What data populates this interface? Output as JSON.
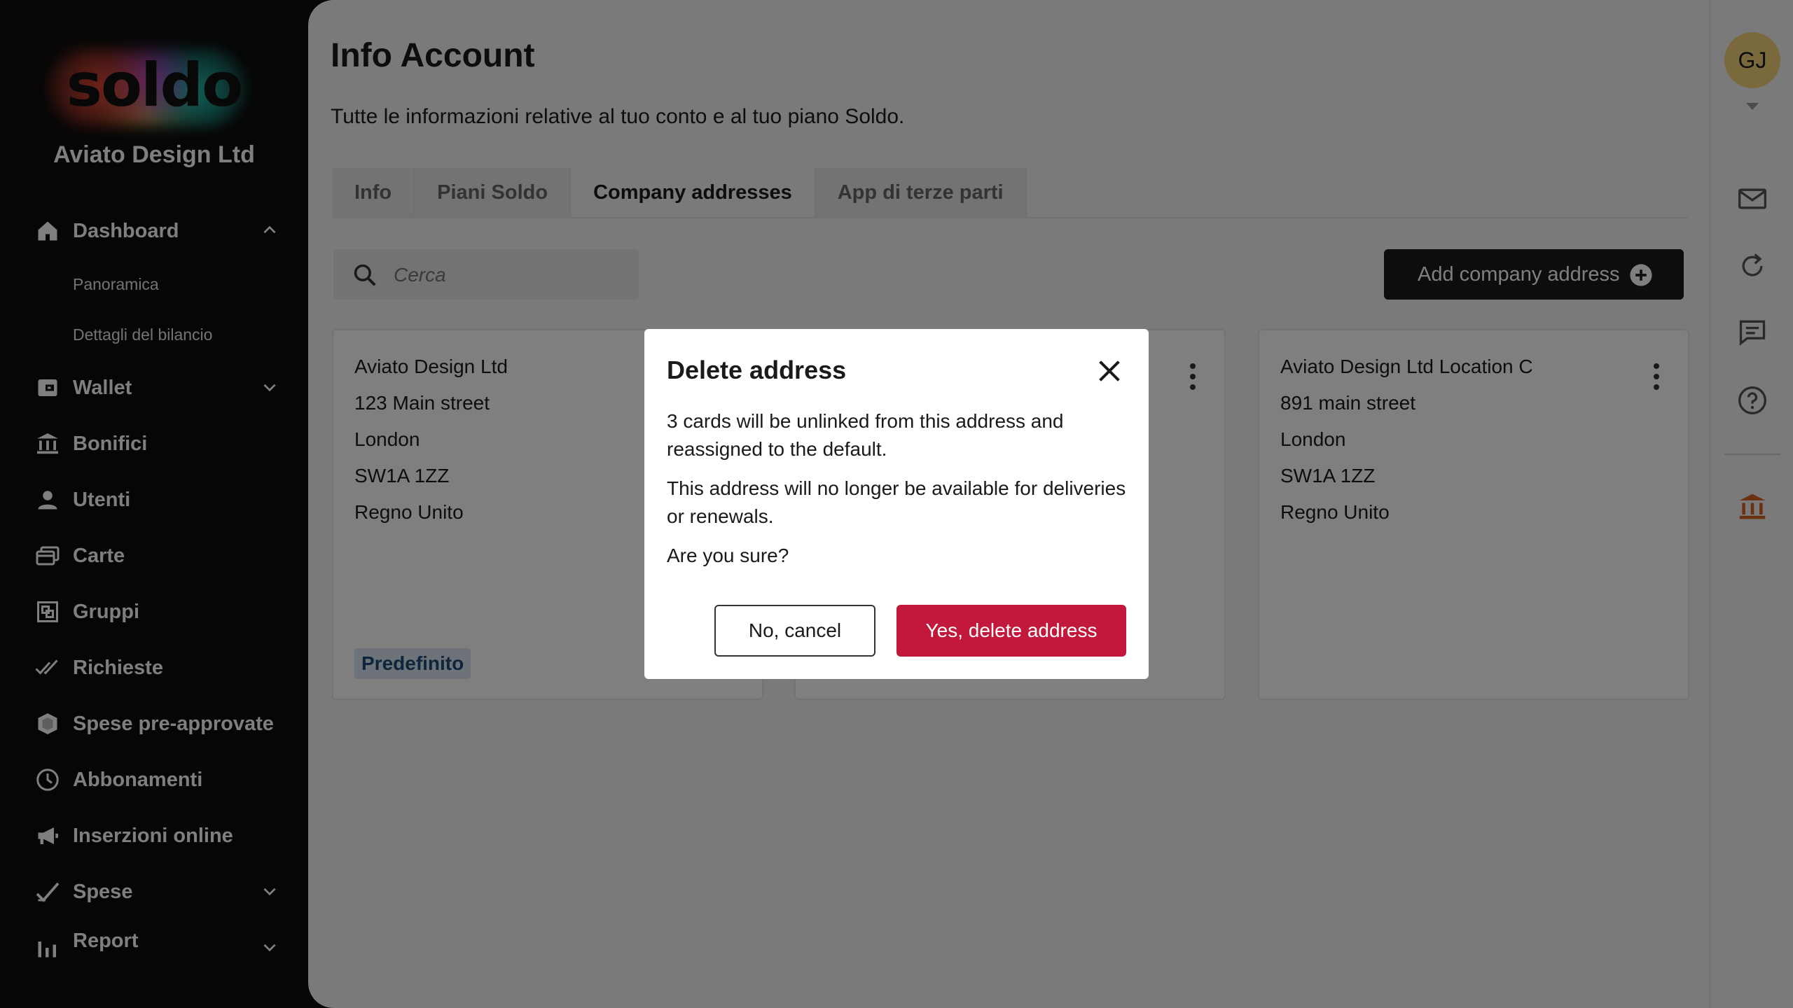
{
  "brand": {
    "logo_text": "soldo",
    "company": "Aviato Design Ltd"
  },
  "sidebar": {
    "items": [
      {
        "label": "Dashboard",
        "icon": "home-icon",
        "expanded": true
      },
      {
        "label": "Panoramica"
      },
      {
        "label": "Dettagli del bilancio"
      },
      {
        "label": "Wallet",
        "icon": "wallet-icon"
      },
      {
        "label": "Bonifici",
        "icon": "bank-transfer-icon"
      },
      {
        "label": "Utenti",
        "icon": "user-icon"
      },
      {
        "label": "Carte",
        "icon": "cards-icon"
      },
      {
        "label": "Gruppi",
        "icon": "groups-icon"
      },
      {
        "label": "Richieste",
        "icon": "double-check-icon"
      },
      {
        "label": "Spese pre-approvate",
        "icon": "shield-icon"
      },
      {
        "label": "Abbonamenti",
        "icon": "clock-icon"
      },
      {
        "label": "Inserzioni online",
        "icon": "megaphone-icon"
      },
      {
        "label": "Spese",
        "icon": "check-icon"
      },
      {
        "label": "Report",
        "icon": "bar-chart-icon"
      }
    ]
  },
  "header": {
    "title": "Info Account",
    "subtitle": "Tutte le informazioni relative al tuo conto e al tuo piano Soldo."
  },
  "tabs": [
    {
      "label": "Info",
      "active": false
    },
    {
      "label": "Piani Soldo",
      "active": false
    },
    {
      "label": "Company addresses",
      "active": true
    },
    {
      "label": "App di terze parti",
      "active": false
    }
  ],
  "search": {
    "placeholder": "Cerca",
    "value": ""
  },
  "add_button": {
    "label": "Add company address"
  },
  "addresses": [
    {
      "lines": [
        "Aviato Design Ltd",
        "123 Main street",
        "London",
        "SW1A 1ZZ",
        "Regno Unito"
      ],
      "badge": "Predefinito"
    },
    {
      "lines": []
    },
    {
      "lines": [
        "Aviato Design Ltd Location C",
        "891 main street",
        "London",
        "SW1A 1ZZ",
        "Regno Unito"
      ]
    }
  ],
  "user": {
    "initials": "GJ"
  },
  "colors": {
    "accent": "#c2183c",
    "dark": "#1a1a1a",
    "rail_bank_icon": "#d9631e",
    "badge_bg": "#dbe6f2"
  },
  "modal": {
    "title": "Delete address",
    "message1": "3 cards will be unlinked from this address and reassigned to the default.",
    "message2": "This address will no longer be available for deliveries or renewals.",
    "message3": "Are you sure?",
    "cancel_label": "No, cancel",
    "confirm_label": "Yes, delete address"
  }
}
